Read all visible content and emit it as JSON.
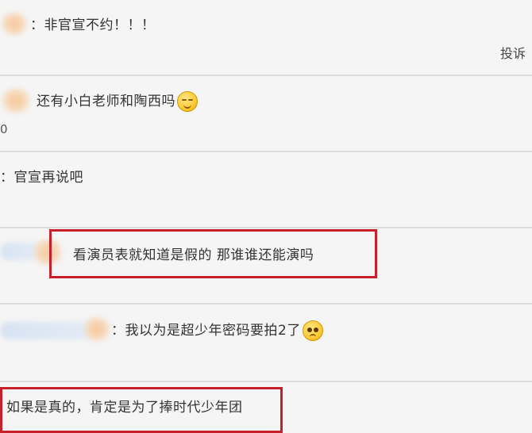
{
  "comments": [
    {
      "text": "：非官宣不约！！！",
      "action": "投诉"
    },
    {
      "text": "还有小白老师和陶西吗",
      "emoji": "smile-icon",
      "extra": "0"
    },
    {
      "text": "：官宣再说吧"
    },
    {
      "text": "看演员表就知道是假的 那谁谁还能演吗",
      "highlighted": true
    },
    {
      "text": "：我以为是超少年密码要拍2了",
      "emoji": "pleading-icon"
    },
    {
      "text": "如果是真的，肯定是为了捧时代少年团",
      "highlighted": true
    }
  ],
  "colors": {
    "highlight": "#c8202a",
    "divider": "#dcdcdc",
    "background": "#f5f5f5"
  }
}
